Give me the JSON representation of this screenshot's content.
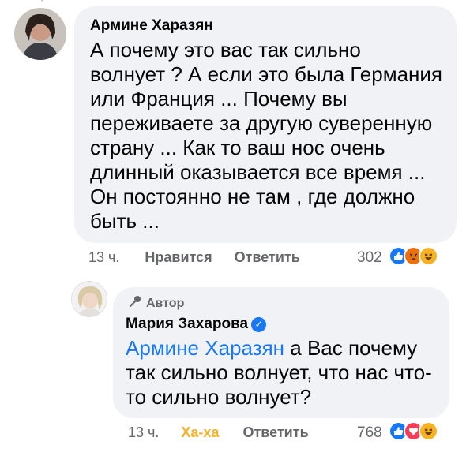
{
  "comment1": {
    "author": "Армине Харазян",
    "text": "А почему это вас так сильно\nволнует ? А если это была Германия\nили Франция ... Почему вы\nпереживаете за другую суверенную\nстрану ... Как то ваш нос очень\nдлинный оказывается все время ...\nОн постоянно не там , где должно\nбыть ...",
    "time": "13 ч.",
    "like_label": "Нравится",
    "reply_label": "Ответить",
    "reaction_count": "302",
    "reactions": [
      "like-icon",
      "angry-icon",
      "haha-icon"
    ]
  },
  "comment2": {
    "author_tag": "Автор",
    "author": "Мария Захарова",
    "verified": "verified-badge-icon",
    "mention": "Армине Харазян",
    "text": " а Вас почему\nтак сильно волнует, что нас что-\nто сильно волнует?",
    "time": "13 ч.",
    "reaction_label": "Ха-ха",
    "reply_label": "Ответить",
    "reaction_count": "768",
    "reactions": [
      "like-icon",
      "love-icon",
      "haha-icon"
    ]
  },
  "colors": {
    "bubble": "#f0f2f5",
    "link": "#1877f2",
    "meta": "#65676b",
    "haha": "#f7b125"
  }
}
